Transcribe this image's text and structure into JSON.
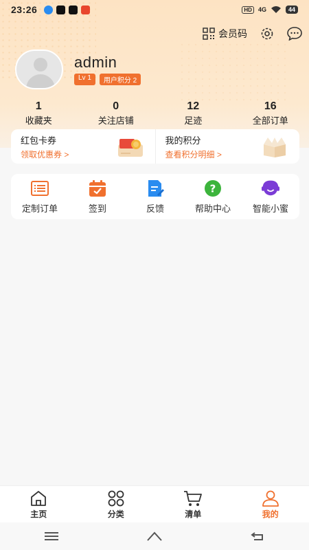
{
  "status_bar": {
    "time": "23:26",
    "network": "4G",
    "hd_label": "HD",
    "battery": "44",
    "app_icons": [
      {
        "name": "qq-browser-icon",
        "color": "#2a8cf0"
      },
      {
        "name": "tiktok-icon",
        "color": "#111111"
      },
      {
        "name": "tiktok-icon",
        "color": "#111111"
      },
      {
        "name": "app-red-icon",
        "color": "#e8452c"
      }
    ]
  },
  "topbar": {
    "member_code_label": "会员码"
  },
  "profile": {
    "username": "admin",
    "level_badge": "Lv 1",
    "points_badge": "用户积分 2"
  },
  "stats": [
    {
      "value": "1",
      "label": "收藏夹"
    },
    {
      "value": "0",
      "label": "关注店铺"
    },
    {
      "value": "12",
      "label": "足迹"
    },
    {
      "value": "16",
      "label": "全部订单"
    }
  ],
  "coupons": {
    "left": {
      "title": "红包卡券",
      "link": "领取优惠券 >"
    },
    "right": {
      "title": "我的积分",
      "link": "查看积分明细 >"
    }
  },
  "menu": [
    {
      "label": "定制订单",
      "icon": "list-icon",
      "color": "#f0702e"
    },
    {
      "label": "签到",
      "icon": "calendar-icon",
      "color": "#f0702e"
    },
    {
      "label": "反馈",
      "icon": "feedback-icon",
      "color": "#2a8cf0"
    },
    {
      "label": "帮助中心",
      "icon": "help-icon",
      "color": "#3cb43c"
    },
    {
      "label": "智能小蜜",
      "icon": "chatbot-icon",
      "color": "#7b3cd6"
    }
  ],
  "tabs": [
    {
      "label": "主页",
      "icon": "home-icon",
      "active": false
    },
    {
      "label": "分类",
      "icon": "category-icon",
      "active": false
    },
    {
      "label": "清单",
      "icon": "cart-icon",
      "active": false
    },
    {
      "label": "我的",
      "icon": "user-icon",
      "active": true
    }
  ],
  "colors": {
    "accent": "#f0702e",
    "header_bg": "#fde3c3"
  }
}
